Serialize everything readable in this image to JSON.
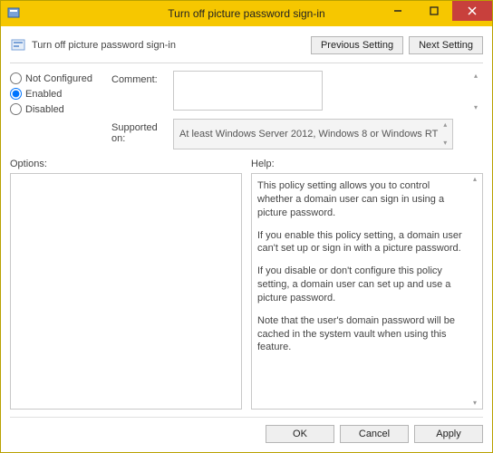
{
  "window": {
    "title": "Turn off picture password sign-in"
  },
  "header": {
    "policy_name": "Turn off picture password sign-in",
    "prev_btn": "Previous Setting",
    "next_btn": "Next Setting"
  },
  "radios": {
    "not_configured": "Not Configured",
    "enabled": "Enabled",
    "disabled": "Disabled",
    "selected": "enabled"
  },
  "fields": {
    "comment_label": "Comment:",
    "comment_value": "",
    "supported_label": "Supported on:",
    "supported_value": "At least Windows Server 2012, Windows 8 or Windows RT"
  },
  "sections": {
    "options_label": "Options:",
    "help_label": "Help:"
  },
  "help_paragraphs": [
    "This policy setting allows you to control whether a domain user can sign in using a picture password.",
    "If you enable this policy setting, a domain user can't set up or sign in with a picture password.",
    "If you disable or don't configure this policy setting, a domain user can set up and use a picture password.",
    "Note that the user's domain password will be cached in the system vault when using this feature."
  ],
  "footer": {
    "ok": "OK",
    "cancel": "Cancel",
    "apply": "Apply"
  }
}
